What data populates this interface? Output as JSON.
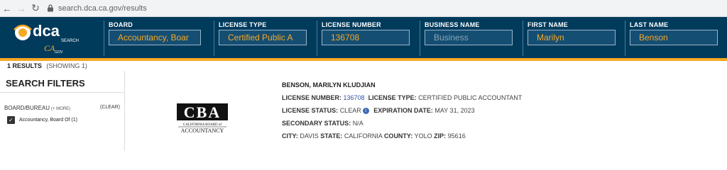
{
  "browser": {
    "url": "search.dca.ca.gov/results",
    "back_icon": "arrow-left-icon",
    "forward_icon": "arrow-right-icon",
    "reload_icon": "reload-icon",
    "lock_icon": "lock-icon"
  },
  "header": {
    "logo_text": "dca",
    "logo_sub": "SEARCH",
    "ca_text": "CA",
    "gov_text": ".GOV",
    "fields": [
      {
        "label": "BOARD",
        "value": "Accountancy, Boar",
        "is_placeholder": false
      },
      {
        "label": "LICENSE TYPE",
        "value": "Certified Public A",
        "is_placeholder": false
      },
      {
        "label": "LICENSE NUMBER",
        "value": "136708",
        "is_placeholder": false
      },
      {
        "label": "BUSINESS NAME",
        "value": "Business",
        "is_placeholder": true
      },
      {
        "label": "FIRST NAME",
        "value": "Marilyn",
        "is_placeholder": false
      },
      {
        "label": "LAST NAME",
        "value": "Benson",
        "is_placeholder": false
      }
    ],
    "colors": {
      "bg": "#003b5c",
      "accent": "#f7a823"
    }
  },
  "results_bar": {
    "count_label": "1 RESULTS",
    "showing_label": "(SHOWING 1)"
  },
  "sidebar": {
    "title": "SEARCH FILTERS",
    "section_label": "BOARD/BUREAU",
    "more_label": "(+ MORE)",
    "clear_label": "(CLEAR)",
    "filter_item": "Accountancy, Board Of (1)",
    "filter_checked": true
  },
  "result": {
    "logo_letters": "CBA",
    "logo_line1": "CALIFORNIA BOARD of",
    "logo_line2": "ACCOUNTANCY",
    "name": "BENSON, MARILYN KLUDJIAN",
    "license_number_label": "LICENSE NUMBER:",
    "license_number": "136708",
    "license_type_label": "LICENSE TYPE:",
    "license_type": "CERTIFIED PUBLIC ACCOUNTANT",
    "license_status_label": "LICENSE STATUS:",
    "license_status": "CLEAR",
    "expiration_label": "EXPIRATION DATE:",
    "expiration": "MAY 31, 2023",
    "secondary_label": "SECONDARY STATUS:",
    "secondary": "N/A",
    "city_label": "CITY:",
    "city": "DAVIS",
    "state_label": "STATE:",
    "state": "CALIFORNIA",
    "county_label": "COUNTY:",
    "county": "YOLO",
    "zip_label": "ZIP:",
    "zip": "95616",
    "info_icon": "info-icon"
  }
}
